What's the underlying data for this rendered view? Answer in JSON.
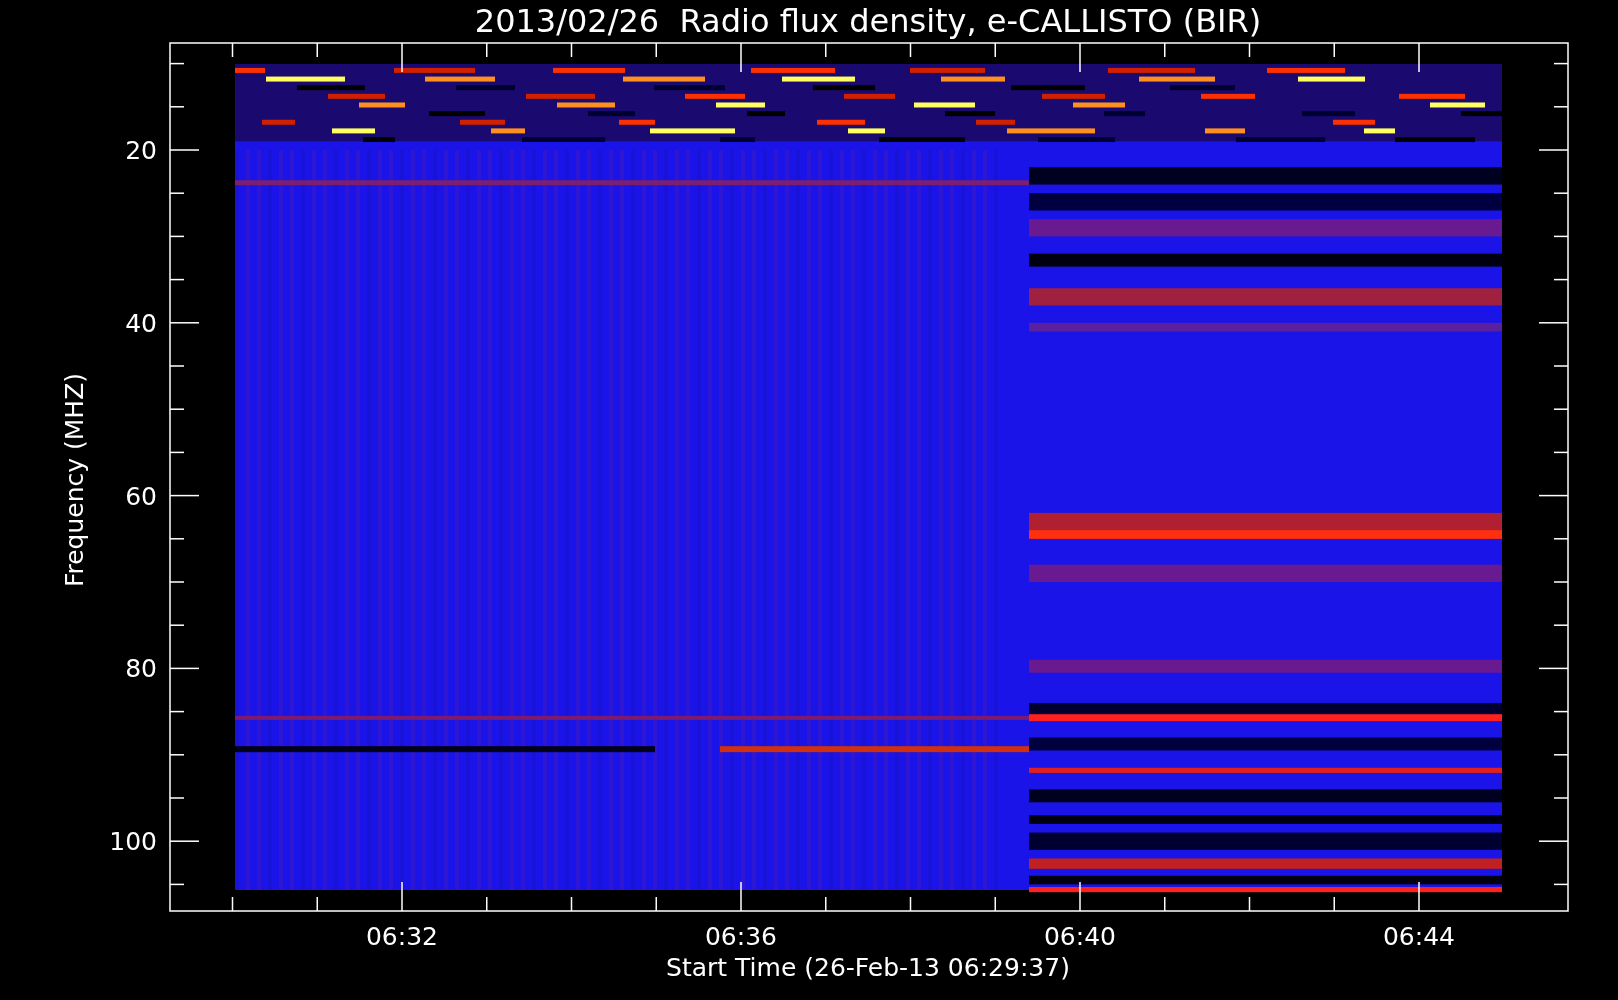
{
  "title": "2013/02/26  Radio flux density, e-CALLISTO (BIR)",
  "y_axis": {
    "label": "Frequency (MHZ)",
    "ticks": [
      "20",
      "40",
      "60",
      "80",
      "100"
    ]
  },
  "x_axis": {
    "label": "Start Time (26-Feb-13 06:29:37)",
    "ticks": [
      "06:32",
      "06:36",
      "06:40",
      "06:44"
    ]
  }
}
